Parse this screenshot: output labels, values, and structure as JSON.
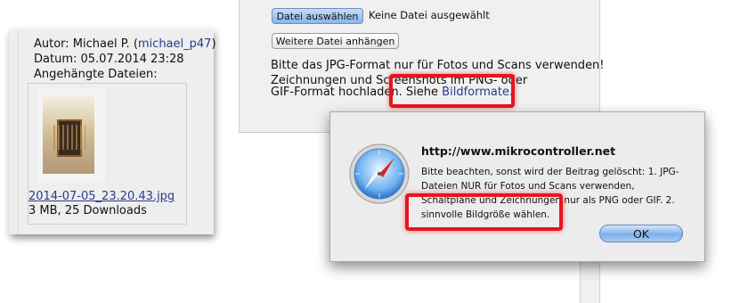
{
  "post": {
    "author_label": "Autor: Michael P. (",
    "author_link": "michael_p47",
    "author_close": ")",
    "date": "Datum: 05.07.2014 23:28",
    "attachments_label": "Angehängte Dateien:",
    "attachment_name": "2014-07-05_23.20.43.jpg",
    "attachment_meta": "3 MB, 25 Downloads"
  },
  "upload_form": {
    "choose_file_button": "Datei auswählen",
    "no_file_text": "Keine Datei ausgewählt",
    "add_file_button": "Weitere Datei anhängen",
    "hint_line1": "Bitte das JPG-Format nur für Fotos und Scans verwenden!",
    "hint_line2": "Zeichnungen und Screenshots im PNG- oder",
    "hint_line3_prefix": "GIF-Format hochladen. Siehe ",
    "hint_link": "Bildformate",
    "hint_line3_suffix": "."
  },
  "dialog": {
    "title": "http://www.mikrocontroller.net",
    "message": "Bitte beachten, sonst wird der Beitrag gelöscht: 1. JPG-Dateien NUR für Fotos und Scans verwenden, Schaltpläne und Zeichnungen nur als PNG oder GIF. 2. sinnvolle Bildgröße wählen.",
    "ok_button": "OK",
    "icon": "safari-compass-icon"
  },
  "colors": {
    "highlight": "#e8141e",
    "link": "#2a3a8a"
  }
}
